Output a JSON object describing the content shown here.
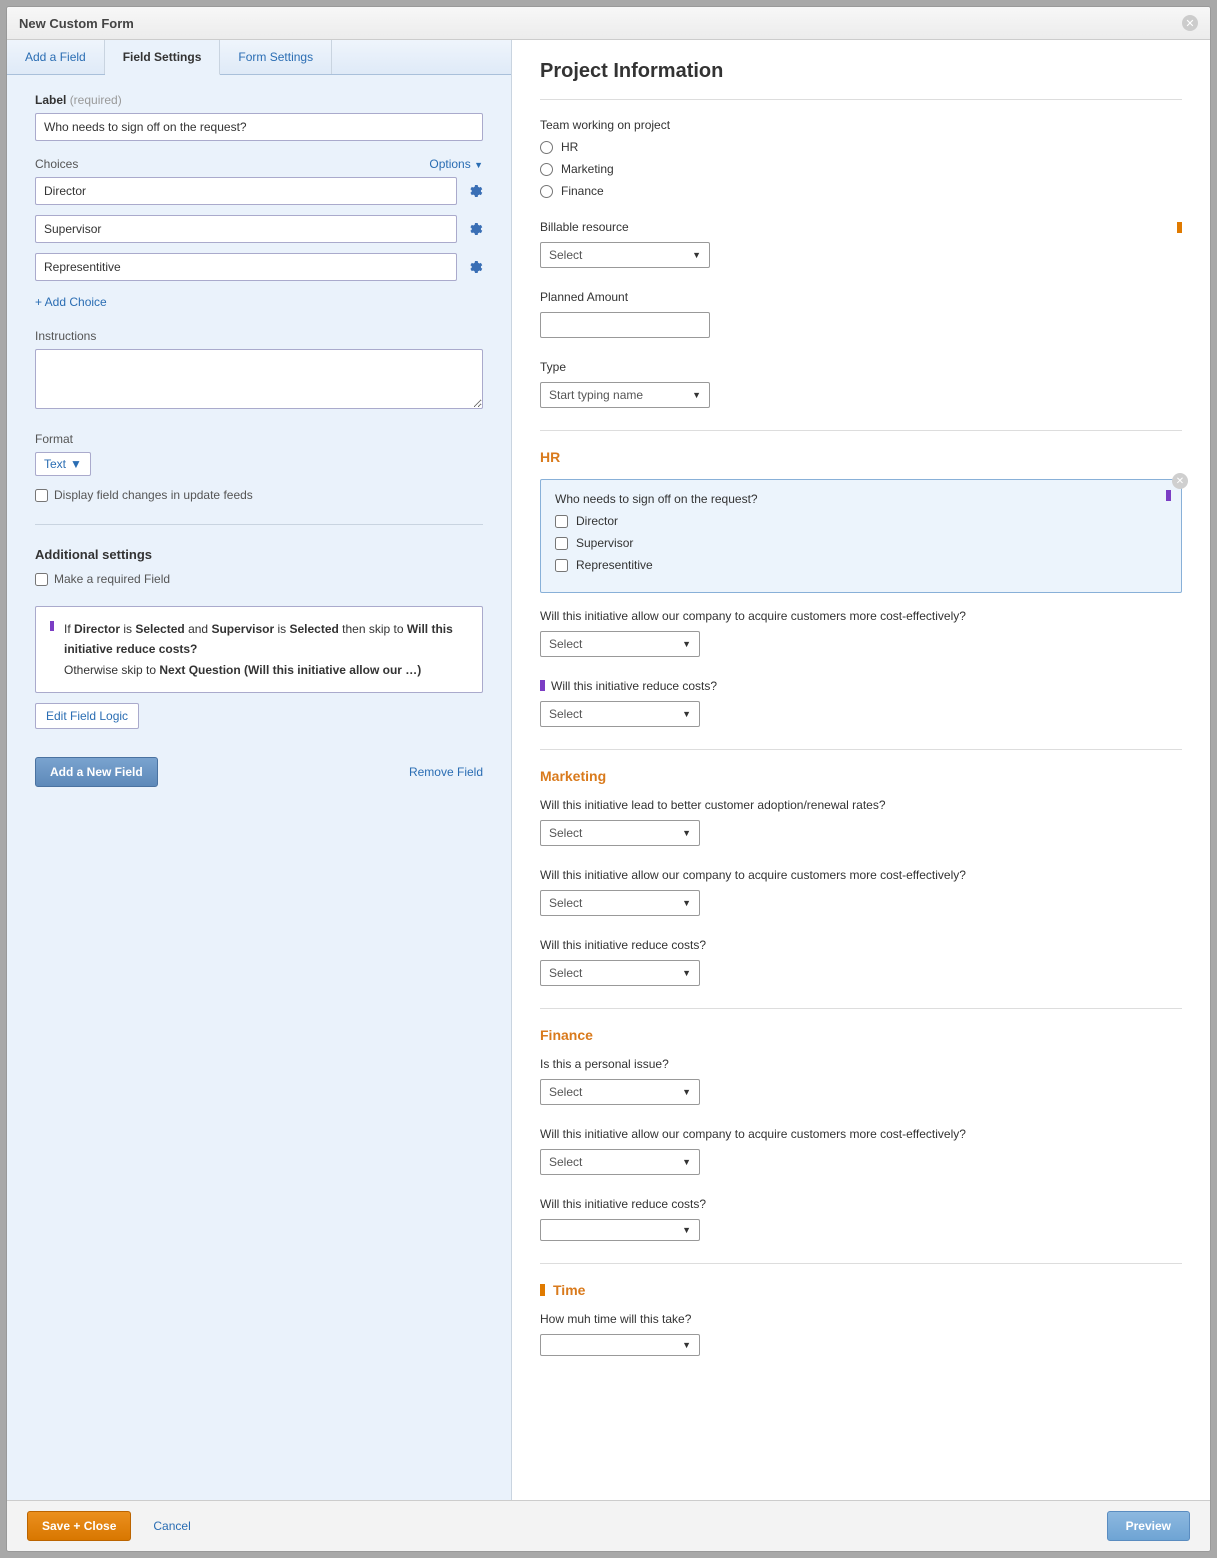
{
  "title": "New Custom Form",
  "tabs": {
    "add": "Add a Field",
    "settings": "Field Settings",
    "form": "Form Settings"
  },
  "left": {
    "label_label": "Label",
    "label_required": "(required)",
    "label_value": "Who needs to sign off on the request?",
    "choices_label": "Choices",
    "options_link": "Options",
    "choice1": "Director",
    "choice2": "Supervisor",
    "choice3": "Representitive",
    "add_choice": "+ Add Choice",
    "instructions_label": "Instructions",
    "format_label": "Format",
    "format_value": "Text",
    "display_changes": "Display field changes in update feeds",
    "additional_title": "Additional settings",
    "make_required": "Make a required Field",
    "logic_if": "If ",
    "logic_director": "Director",
    "logic_is1": " is ",
    "logic_sel1": "Selected",
    "logic_and": " and ",
    "logic_supervisor": "Supervisor",
    "logic_is2": " is ",
    "logic_sel2": "Selected",
    "logic_then": " then skip to ",
    "logic_target": "Will this initiative reduce costs?",
    "logic_otherwise": "Otherwise skip to ",
    "logic_next": "Next Question (Will this initiative allow our …)",
    "edit_logic": "Edit Field Logic",
    "add_new_field": "Add a New Field",
    "remove_field": "Remove Field"
  },
  "form": {
    "title": "Project Information",
    "team_label": "Team working on project",
    "opt_hr": "HR",
    "opt_marketing": "Marketing",
    "opt_finance": "Finance",
    "billable": "Billable resource",
    "select": "Select",
    "planned": "Planned Amount",
    "type": "Type",
    "type_placeholder": "Start typing name",
    "hr_heading": "HR",
    "signoff_q": "Who needs to sign off on the request?",
    "c_director": "Director",
    "c_supervisor": "Supervisor",
    "c_rep": "Representitive",
    "q_acquire": "Will this initiative allow our company to acquire customers more cost-effectively?",
    "q_reduce": "Will this initiative reduce costs?",
    "mkt_heading": "Marketing",
    "q_adoption": "Will this initiative lead to better customer adoption/renewal rates?",
    "fin_heading": "Finance",
    "q_personal": "Is this a personal issue?",
    "time_heading": "Time",
    "q_time": "How muh time will this take?"
  },
  "footer": {
    "save": "Save + Close",
    "cancel": "Cancel",
    "preview": "Preview"
  }
}
